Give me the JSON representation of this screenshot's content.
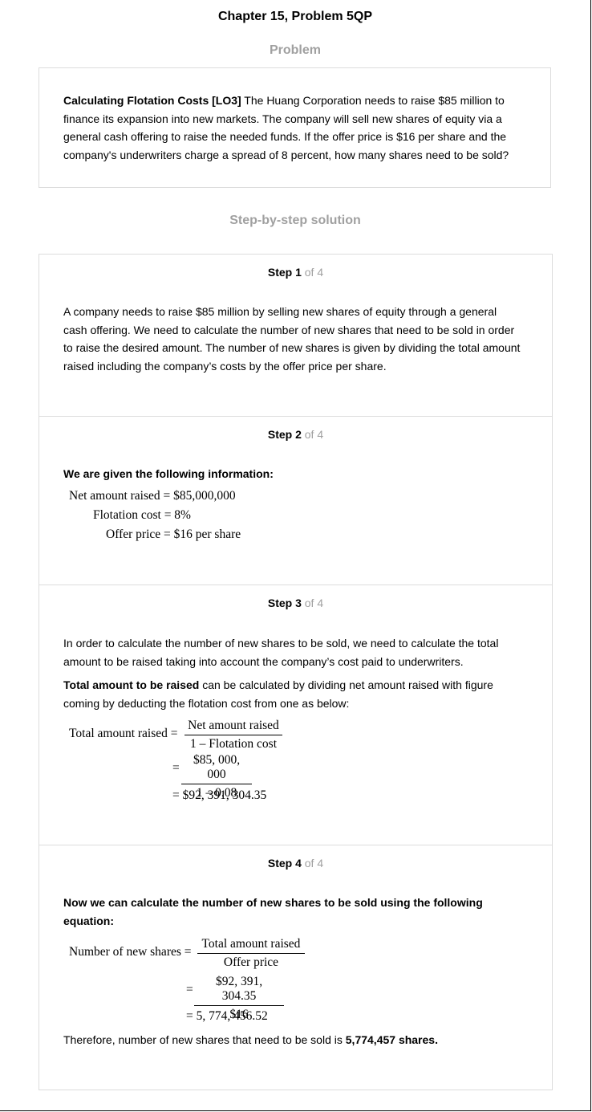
{
  "header": {
    "chapter_title": "Chapter 15, Problem 5QP"
  },
  "problem": {
    "section_title": "Problem",
    "lead_bold": "Calculating Flotation Costs [LO3]",
    "lines": [
      " The Huang Corporation needs to raise $85 million to",
      "finance its expansion into new markets. The company will sell new shares of equity via a",
      "general cash offering to raise the needed funds. If the offer price is $16 per share and the",
      "company's underwriters charge a spread of 8 percent, how many shares need to be sold?"
    ]
  },
  "solution": {
    "section_title": "Step-by-step solution"
  },
  "steps": [
    {
      "label": "Step 1",
      "of": " of 4",
      "lines": [
        "A company needs to raise $85 million by selling new shares of equity through a general",
        "cash offering. We need to calculate the number of new shares that need to be sold in order",
        "to raise the desired amount. The number of new shares is given by dividing the total amount",
        "raised including the company’s costs by the offer price per share."
      ]
    },
    {
      "label": "Step 2",
      "of": " of 4",
      "heading": "We are given the following information:",
      "given": [
        "Net amount raised = $85,000,000",
        "Flotation cost = 8%",
        "Offer price = $16 per share"
      ]
    },
    {
      "label": "Step 3",
      "of": " of 4",
      "lines": [
        "In order to calculate the number of new shares to be sold, we need to calculate the total",
        "amount to be raised taking into account the company’s cost paid to underwriters."
      ],
      "bold_lead": "Total amount to be raised",
      "lines2": [
        " can be calculated by dividing net amount raised with figure",
        "coming by deducting the flotation cost from one as below:"
      ],
      "eq_lhs": "Total amount raised =",
      "frac1_num": "Net amount raised",
      "frac1_den": "1 – Flotation cost",
      "eq": "=",
      "frac2_num": "$85, 000, 000",
      "frac2_den": "1 – 0.08",
      "result": "= $92, 391, 304.35"
    },
    {
      "label": "Step 4",
      "of": " of 4",
      "heading_lines": [
        "Now we can calculate the number of new shares to be sold using the following",
        "equation:"
      ],
      "eq_lhs": "Number of new shares =",
      "frac1_num": "Total amount raised",
      "frac1_den": "Offer price",
      "eq": "=",
      "frac2_num": "$92, 391, 304.35",
      "frac2_den": "$16",
      "result": "= 5, 774, 456.52",
      "conclusion": "Therefore, number of new shares that need to be sold is ",
      "conclusion_bold": "5,774,457 shares."
    }
  ]
}
